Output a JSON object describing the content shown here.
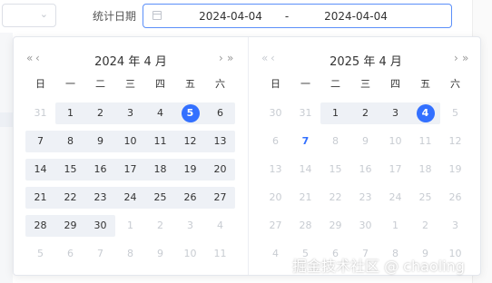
{
  "filter": {
    "label": "统计日期",
    "start": "2024-04-04",
    "separator": "-",
    "end": "2024-04-04"
  },
  "icons": {
    "prev_year": "«",
    "prev_month": "‹",
    "next_month": "›",
    "next_year": "»",
    "chevron": "⌄"
  },
  "weekdays": [
    "日",
    "一",
    "二",
    "三",
    "四",
    "五",
    "六"
  ],
  "left_calendar": {
    "title": "2024 年 4 月",
    "weeks": [
      [
        "31",
        "1",
        "2",
        "3",
        "4",
        "5",
        "6"
      ],
      [
        "7",
        "8",
        "9",
        "10",
        "11",
        "12",
        "13"
      ],
      [
        "14",
        "15",
        "16",
        "17",
        "18",
        "19",
        "20"
      ],
      [
        "21",
        "22",
        "23",
        "24",
        "25",
        "26",
        "27"
      ],
      [
        "28",
        "29",
        "30",
        "1",
        "2",
        "3",
        "4"
      ],
      [
        "5",
        "6",
        "7",
        "8",
        "9",
        "10",
        "11"
      ]
    ]
  },
  "right_calendar": {
    "title": "2025 年 4 月",
    "weeks": [
      [
        "30",
        "31",
        "1",
        "2",
        "3",
        "4",
        "5"
      ],
      [
        "6",
        "7",
        "8",
        "9",
        "10",
        "11",
        "12"
      ],
      [
        "13",
        "14",
        "15",
        "16",
        "17",
        "18",
        "19"
      ],
      [
        "20",
        "21",
        "22",
        "23",
        "24",
        "25",
        "26"
      ],
      [
        "27",
        "28",
        "29",
        "30",
        "1",
        "2",
        "3"
      ],
      [
        "4",
        "5",
        "6",
        "7",
        "8",
        "9",
        "10"
      ]
    ]
  },
  "watermark": "掘金技术社区 @ chaoling",
  "colors": {
    "accent": "#3370ff",
    "range_bg": "#eef1f6",
    "muted": "#c8ccd2"
  }
}
